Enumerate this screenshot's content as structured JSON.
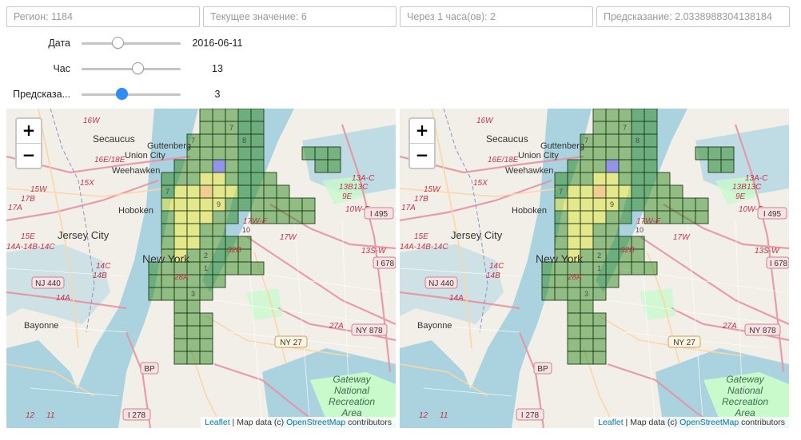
{
  "fields": [
    {
      "name": "region-field",
      "value": "Регион: 1184"
    },
    {
      "name": "current-value-field",
      "value": "Текущее значение: 6"
    },
    {
      "name": "in-hours-field",
      "value": "Через 1 часа(ов): 2"
    },
    {
      "name": "prediction-field",
      "value": "Предсказание: 2.0338988304138184"
    }
  ],
  "sliders": [
    {
      "name": "date-slider",
      "label": "Дата",
      "value": "2016-06-11",
      "position": 0.37,
      "active": false
    },
    {
      "name": "hour-slider",
      "label": "Час",
      "value": "13",
      "position": 0.57,
      "active": false
    },
    {
      "name": "prediction-slider",
      "label": "Предсказа...",
      "value": "3",
      "position": 0.41,
      "active": true
    }
  ],
  "maps": [
    {
      "name": "map-left",
      "zoom_in_label": "+",
      "zoom_out_label": "−",
      "attribution": {
        "leaflet": "Leaflet",
        "map_data": "Map data (c)",
        "osm": "OpenStreetMap",
        "contributors": "contributors"
      }
    },
    {
      "name": "map-right",
      "zoom_in_label": "+",
      "zoom_out_label": "−",
      "attribution": {
        "leaflet": "Leaflet",
        "map_data": "Map data (c)",
        "osm": "OpenStreetMap",
        "contributors": "contributors"
      }
    }
  ],
  "map_labels": {
    "secaucus": "Secaucus",
    "union_city": "Union City",
    "guttenberg": "Guttenberg",
    "weehawken": "Weehawken",
    "hoboken": "Hoboken",
    "jersey_city": "Jersey City",
    "new_york": "New York",
    "bayonne": "Bayonne",
    "gateway_1": "Gateway",
    "gateway_2": "National",
    "gateway_3": "Recreation",
    "gateway_4": "Area"
  },
  "road_shields": {
    "i495": "I 495",
    "i678": "I 678",
    "nj440": "NJ 440",
    "ny878": "NY 878",
    "ny27": "NY 27",
    "bp": "BP",
    "i278": "I 278"
  },
  "exit_labels": {
    "e16w": "16W",
    "e16e18e": "16E/18E",
    "e15x": "15X",
    "e15w": "15W",
    "e17b": "17B",
    "e17a": "17A",
    "e15e": "15E",
    "e14a": "14A-14B-14C",
    "e14c": "14C",
    "e14b": "14B",
    "e14a2": "14A",
    "e13ac": "13A-C",
    "e13b": "13B",
    "e13c": "13C",
    "e10we": "10W-E",
    "e13sw": "13S-W",
    "e17we": "17W-E",
    "e17w": "17W",
    "e32b": "32B",
    "e28a": "28A",
    "e27a": "27A",
    "e9e": "9E",
    "e12": "12",
    "e11": "11",
    "e1": "1"
  },
  "colors": {
    "map_bg": "#f2efe9",
    "water": "#aad3df",
    "park": "#c8facc",
    "cell_green": "#2f8a1f",
    "cell_yellow": "#d8e03c",
    "cell_orange": "#f2b456",
    "cell_blue": "#6b6ee8"
  }
}
